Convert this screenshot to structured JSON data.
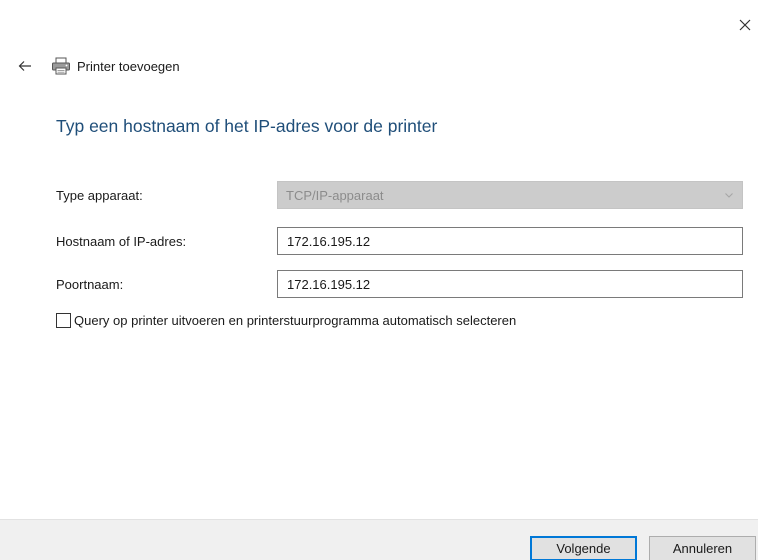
{
  "window": {
    "close_icon": "close-icon"
  },
  "header": {
    "back_icon": "arrow-left-icon",
    "printer_icon": "printer-icon",
    "title": "Printer toevoegen"
  },
  "instruction": "Typ een hostnaam of het IP-adres voor de printer",
  "form": {
    "device_type": {
      "label": "Type apparaat:",
      "value": "TCP/IP-apparaat",
      "disabled": true
    },
    "hostname": {
      "label": "Hostnaam of IP-adres:",
      "value": "172.16.195.12"
    },
    "port": {
      "label": "Poortnaam:",
      "value": "172.16.195.12"
    },
    "query_printer": {
      "label": "Query op printer uitvoeren en printerstuurprogramma automatisch selecteren",
      "checked": false
    }
  },
  "footer": {
    "next_label": "Volgende",
    "cancel_label": "Annuleren"
  },
  "colors": {
    "instruction_text": "#1f4e79",
    "primary_button_border": "#0078d7",
    "footer_background": "#f0f0f0"
  }
}
